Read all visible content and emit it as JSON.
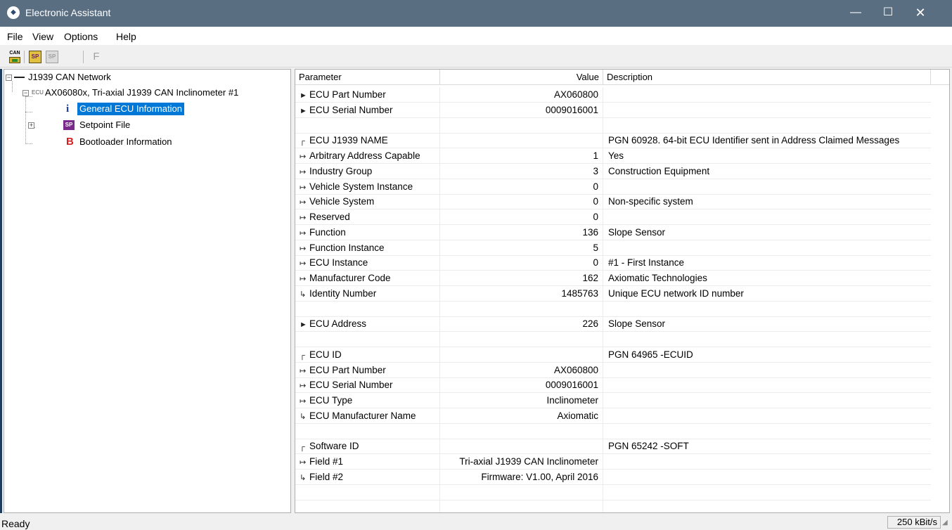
{
  "window": {
    "title": "Electronic Assistant",
    "icon": "app-logo-icon",
    "controls": {
      "minimize": "—",
      "maximize": "☐",
      "close": "✕"
    }
  },
  "menu": {
    "file": "File",
    "view": "View",
    "options": "Options",
    "help": "Help"
  },
  "toolbar": {
    "can_icon_text": "CAN",
    "sp_icon_text": "SP",
    "sp2_icon_text": "SP",
    "f_label": "F"
  },
  "tree": {
    "root": "J1939 CAN Network",
    "ecu_prefix": "ECU",
    "ecu": "AX06080x, Tri-axial J1939 CAN Inclinometer #1",
    "items": [
      {
        "icon_text": "i",
        "label": "General ECU Information"
      },
      {
        "icon_text": "SP",
        "label": "Setpoint File"
      },
      {
        "icon_text": "B",
        "label": "Bootloader Information"
      }
    ]
  },
  "grid": {
    "headers": {
      "parameter": "Parameter",
      "value": "Value",
      "description": "Description"
    },
    "rows": [
      {
        "mark": "►",
        "param": "ECU Part Number",
        "value": "AX060800",
        "desc": ""
      },
      {
        "mark": "►",
        "param": "ECU Serial Number",
        "value": "0009016001",
        "desc": ""
      },
      {
        "mark": "",
        "param": "",
        "value": "",
        "desc": ""
      },
      {
        "mark": "┌",
        "param": "ECU J1939 NAME",
        "value": "",
        "desc": "PGN 60928. 64-bit ECU Identifier sent in Address Claimed Messages"
      },
      {
        "mark": "↦",
        "param": "Arbitrary Address Capable",
        "value": "1",
        "desc": "Yes"
      },
      {
        "mark": "↦",
        "param": "Industry Group",
        "value": "3",
        "desc": "Construction Equipment"
      },
      {
        "mark": "↦",
        "param": "Vehicle System Instance",
        "value": "0",
        "desc": ""
      },
      {
        "mark": "↦",
        "param": "Vehicle System",
        "value": "0",
        "desc": "Non-specific system"
      },
      {
        "mark": "↦",
        "param": "Reserved",
        "value": "0",
        "desc": ""
      },
      {
        "mark": "↦",
        "param": "Function",
        "value": "136",
        "desc": "Slope Sensor"
      },
      {
        "mark": "↦",
        "param": "Function Instance",
        "value": "5",
        "desc": ""
      },
      {
        "mark": "↦",
        "param": "ECU Instance",
        "value": "0",
        "desc": "#1 - First Instance"
      },
      {
        "mark": "↦",
        "param": "Manufacturer Code",
        "value": "162",
        "desc": "Axiomatic Technologies"
      },
      {
        "mark": "↳",
        "param": "Identity Number",
        "value": "1485763",
        "desc": "Unique ECU network ID number"
      },
      {
        "mark": "",
        "param": "",
        "value": "",
        "desc": ""
      },
      {
        "mark": "►",
        "param": "ECU Address",
        "value": "226",
        "desc": "Slope Sensor"
      },
      {
        "mark": "",
        "param": "",
        "value": "",
        "desc": ""
      },
      {
        "mark": "┌",
        "param": "ECU ID",
        "value": "",
        "desc": "PGN 64965   -ECUID"
      },
      {
        "mark": "↦",
        "param": "ECU Part Number",
        "value": "AX060800",
        "desc": ""
      },
      {
        "mark": "↦",
        "param": "ECU Serial Number",
        "value": "0009016001",
        "desc": ""
      },
      {
        "mark": "↦",
        "param": "ECU Type",
        "value": "Inclinometer",
        "desc": ""
      },
      {
        "mark": "↳",
        "param": "ECU Manufacturer Name",
        "value": "Axiomatic",
        "desc": ""
      },
      {
        "mark": "",
        "param": "",
        "value": "",
        "desc": ""
      },
      {
        "mark": "┌",
        "param": "Software ID",
        "value": "",
        "desc": "PGN 65242   -SOFT"
      },
      {
        "mark": "↦",
        "param": "Field #1",
        "value": "Tri-axial J1939 CAN Inclinometer",
        "desc": ""
      },
      {
        "mark": "↳",
        "param": "Field #2",
        "value": "Firmware: V1.00, April 2016",
        "desc": ""
      },
      {
        "mark": "",
        "param": "",
        "value": "",
        "desc": ""
      },
      {
        "mark": "",
        "param": "",
        "value": "",
        "desc": ""
      }
    ]
  },
  "status": {
    "text": "Ready",
    "baud": "250 kBit/s"
  },
  "colors": {
    "titlebar": "#5a6e82",
    "selection": "#0078d7",
    "bootloader_icon": "#d42020",
    "sp_icon": "#7a2a8a"
  }
}
